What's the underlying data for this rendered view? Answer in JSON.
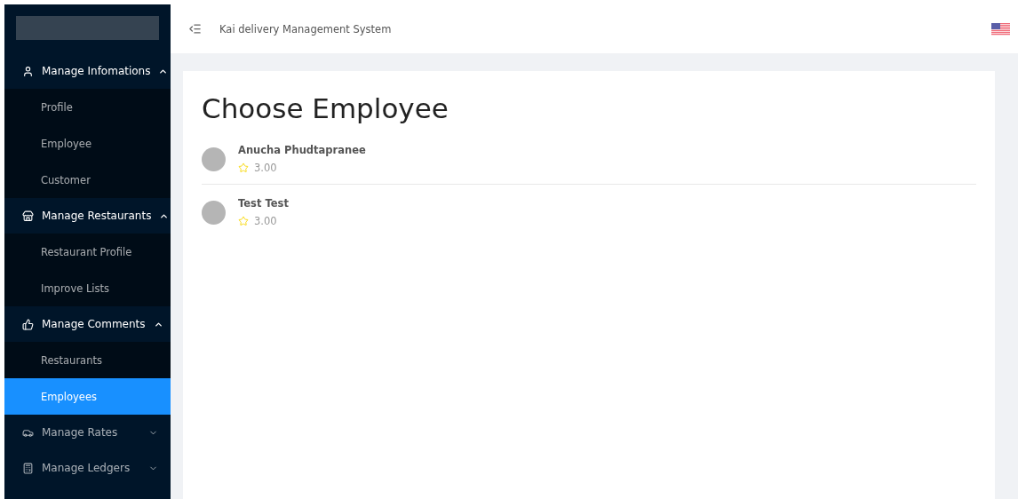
{
  "sidebar": {
    "groups": [
      {
        "label": "Manage Infomations",
        "expanded": true,
        "children": [
          {
            "label": "Profile",
            "selected": false
          },
          {
            "label": "Employee",
            "selected": false
          },
          {
            "label": "Customer",
            "selected": false
          }
        ]
      },
      {
        "label": "Manage Restaurants",
        "expanded": true,
        "children": [
          {
            "label": "Restaurant Profile",
            "selected": false
          },
          {
            "label": "Improve Lists",
            "selected": false
          }
        ]
      },
      {
        "label": "Manage Comments",
        "expanded": true,
        "children": [
          {
            "label": "Restaurants",
            "selected": false
          },
          {
            "label": "Employees",
            "selected": true
          }
        ]
      },
      {
        "label": "Manage Rates",
        "expanded": false
      },
      {
        "label": "Manage Ledgers",
        "expanded": false
      }
    ]
  },
  "header": {
    "title": "Kai delivery Management System"
  },
  "page": {
    "title": "Choose Employee",
    "employees": [
      {
        "name": "Anucha Phudtapranee",
        "rating": "3.00"
      },
      {
        "name": "Test Test",
        "rating": "3.00"
      }
    ]
  }
}
